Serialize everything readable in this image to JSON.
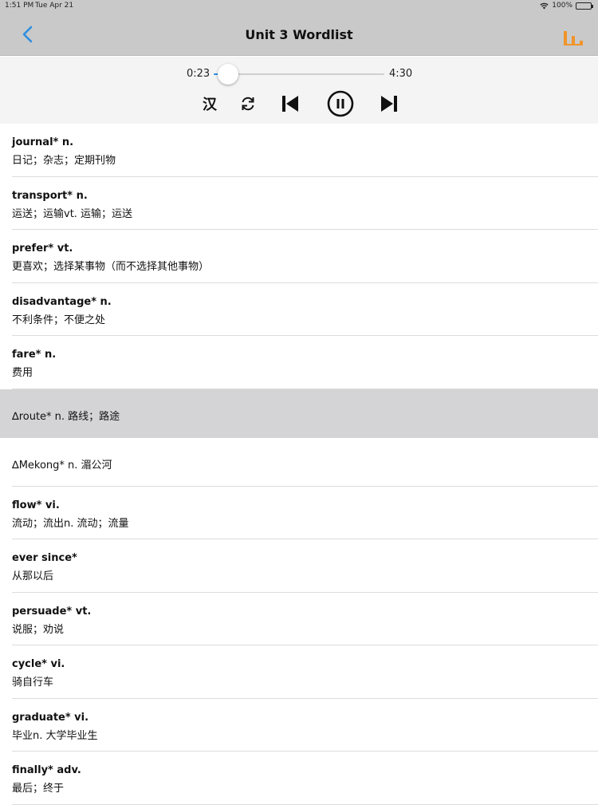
{
  "status_bar": {
    "time": "1:51 PM",
    "date": "Tue Apr 21",
    "battery": "100%"
  },
  "nav": {
    "title": "Unit 3 Wordlist",
    "back_icon": "chevron-left-icon",
    "right_icon": "levels-icon",
    "accent_color": "#2d8fe2",
    "right_icon_color": "#f0952a"
  },
  "player": {
    "elapsed": "0:23",
    "total": "4:30",
    "progress": 0.085,
    "han_label": "汉"
  },
  "words": [
    {
      "head": "journal* n.",
      "def": "日记；杂志；定期刊物"
    },
    {
      "head": "transport* n.",
      "def": "运送；运输vt. 运输；运送"
    },
    {
      "head": "prefer* vt.",
      "def": "更喜欢；选择某事物（而不选择其他事物）"
    },
    {
      "head": "disadvantage* n.",
      "def": "不利条件；不便之处"
    },
    {
      "head": "fare* n.",
      "def": "费用"
    },
    {
      "single": "∆route* n. 路线；路途",
      "selected": true
    },
    {
      "single": "∆Mekong* n. 湄公河"
    },
    {
      "head": "flow* vi.",
      "def": "流动；流出n. 流动；流量"
    },
    {
      "head": "ever since*",
      "def": "从那以后"
    },
    {
      "head": "persuade* vt.",
      "def": "说服；劝说"
    },
    {
      "head": "cycle* vi.",
      "def": "骑自行车"
    },
    {
      "head": "graduate* vi.",
      "def": "毕业n. 大学毕业生"
    },
    {
      "head": "finally* adv.",
      "def": "最后；终于"
    }
  ]
}
